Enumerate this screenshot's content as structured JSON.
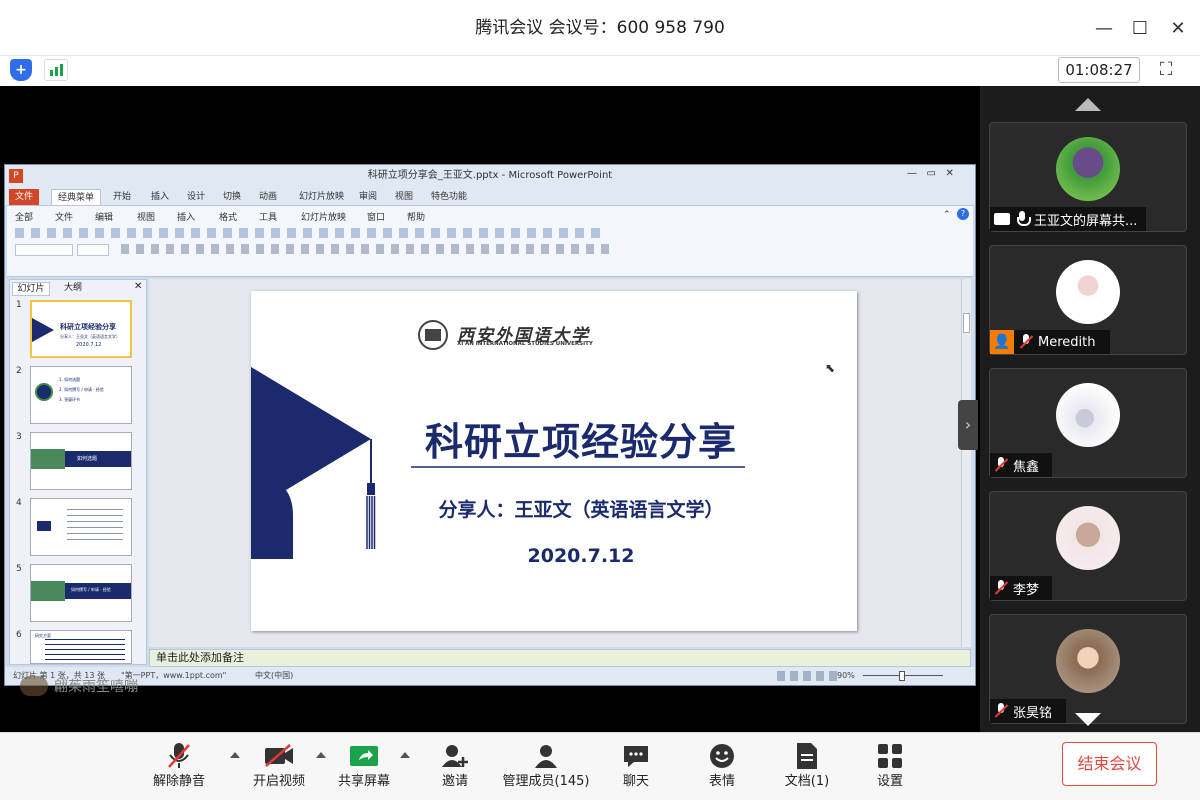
{
  "window": {
    "title": "腾讯会议 会议号：600 958 790",
    "timer": "01:08:27"
  },
  "ppt": {
    "title": "科研立项分享会_王亚文.pptx - Microsoft PowerPoint",
    "tabs": [
      "文件",
      "经典菜单",
      "开始",
      "插入",
      "设计",
      "切换",
      "动画",
      "幻灯片放映",
      "审阅",
      "视图",
      "特色功能"
    ],
    "menu": [
      "全部",
      "文件",
      "编辑",
      "视图",
      "插入",
      "格式",
      "工具",
      "幻灯片放映",
      "窗口",
      "帮助"
    ],
    "pane_tabs": [
      "幻灯片",
      "大纲"
    ],
    "slide": {
      "university_cn": "西安外国语大学",
      "university_en": "XI'AN INTERNATIONAL STUDIES UNIVERSITY",
      "title": "科研立项经验分享",
      "presenter": "分享人：王亚文（英语语言文学）",
      "date": "2020.7.12"
    },
    "thumbs": [
      {
        "num": "1",
        "title": "科研立项经验分享",
        "line": "分享人：王亚文（英语语言文学）",
        "date": "2020.7.12"
      },
      {
        "num": "2",
        "l1": "1. 如何选题",
        "l2": "2. 如何撰写 / 申请 · 经验",
        "l3": "3. 答疑环节"
      },
      {
        "num": "3",
        "text": "如何选题"
      },
      {
        "num": "4"
      },
      {
        "num": "5",
        "text": "如何撰写 / 申请 · 经验"
      },
      {
        "num": "6",
        "text": "研究方案"
      }
    ],
    "notes": "单击此处添加备注",
    "status": {
      "slide": "幻灯片 第 1 张，共 13 张",
      "theme": "\"第一PPT，www.1ppt.com\"",
      "lang": "中文(中国)",
      "zoom": "90%"
    }
  },
  "watermark": "翩茱雨笙嘻嘣",
  "participants": [
    {
      "name": "王亚文的屏幕共...",
      "mic": "on",
      "sharing": true,
      "colors": [
        "#6a4b8a",
        "#3f9a3a"
      ]
    },
    {
      "name": "Meredith",
      "mic": "off",
      "badge": true,
      "colors": [
        "#ffffff",
        "#f0d2d2"
      ]
    },
    {
      "name": "焦鑫",
      "mic": "off",
      "colors": [
        "#ffffff",
        "#e8e8f2"
      ]
    },
    {
      "name": "李梦",
      "mic": "off",
      "colors": [
        "#f2e6e6",
        "#c9a79a"
      ]
    },
    {
      "name": "张昊铭",
      "mic": "off",
      "colors": [
        "#b8a796",
        "#8a6a52"
      ]
    }
  ],
  "bottom": {
    "unmute": "解除静音",
    "video": "开启视频",
    "share": "共享屏幕",
    "invite": "邀请",
    "members": "管理成员(145)",
    "chat": "聊天",
    "emoji": "表情",
    "docs": "文档(1)",
    "settings": "设置",
    "end": "结束会议"
  },
  "colors": {
    "accent": "#1a2a6c",
    "danger": "#e04a3f",
    "share": "#1aa34a"
  }
}
